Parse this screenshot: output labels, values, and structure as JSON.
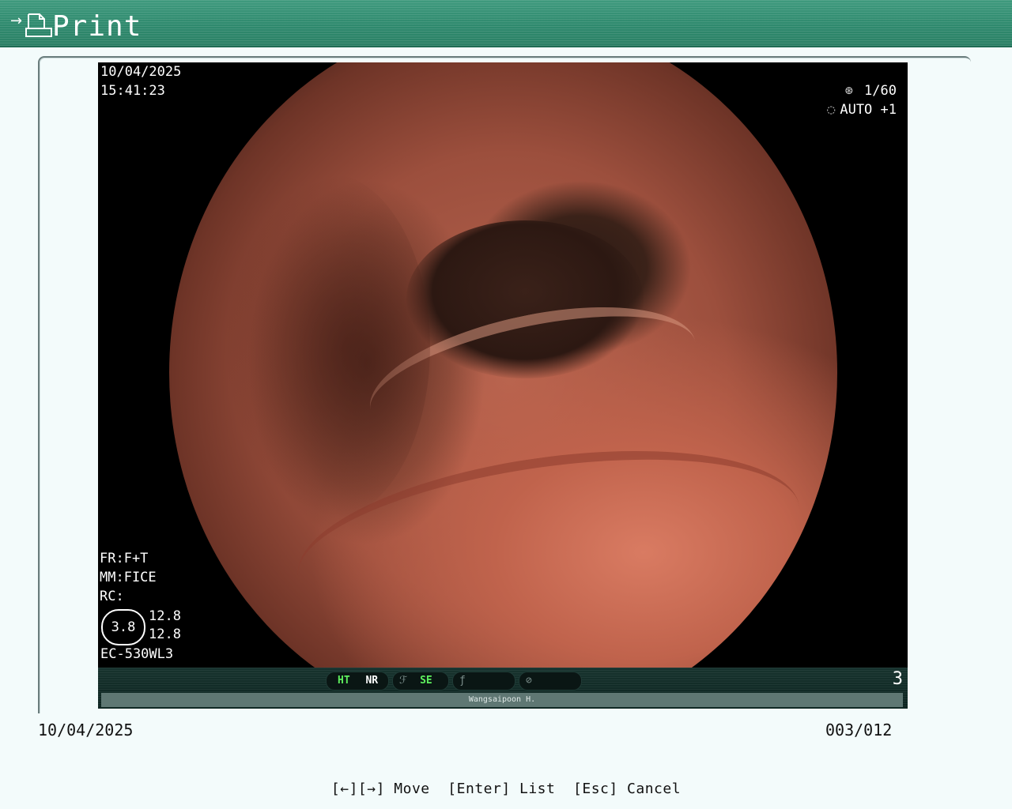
{
  "header": {
    "title": "Print",
    "arrow_icon": "arrow-right-icon",
    "print_icon": "print-document-icon"
  },
  "image_overlay": {
    "date": "10/04/2025",
    "time": "15:41:23",
    "shutter": "1/60",
    "iris": "AUTO +1",
    "fr": "FR:F+T",
    "mm": "MM:FICE",
    "rc": "RC:",
    "scale_center": "3.8",
    "scale_top": "12.8",
    "scale_bottom": "12.8",
    "scope_model": "EC-530WL3",
    "status": {
      "ht": "HT",
      "nr": "NR",
      "se": "SE",
      "page": "3",
      "operator": "Wangsaipoon H."
    }
  },
  "footer": {
    "date": "10/04/2025",
    "counter": "003/012",
    "help": "[←][→] Move  [Enter] List  [Esc] Cancel"
  },
  "colors": {
    "header": "#2f8a6e",
    "background": "#f3fbfb",
    "accent_green": "#5ef05e"
  }
}
